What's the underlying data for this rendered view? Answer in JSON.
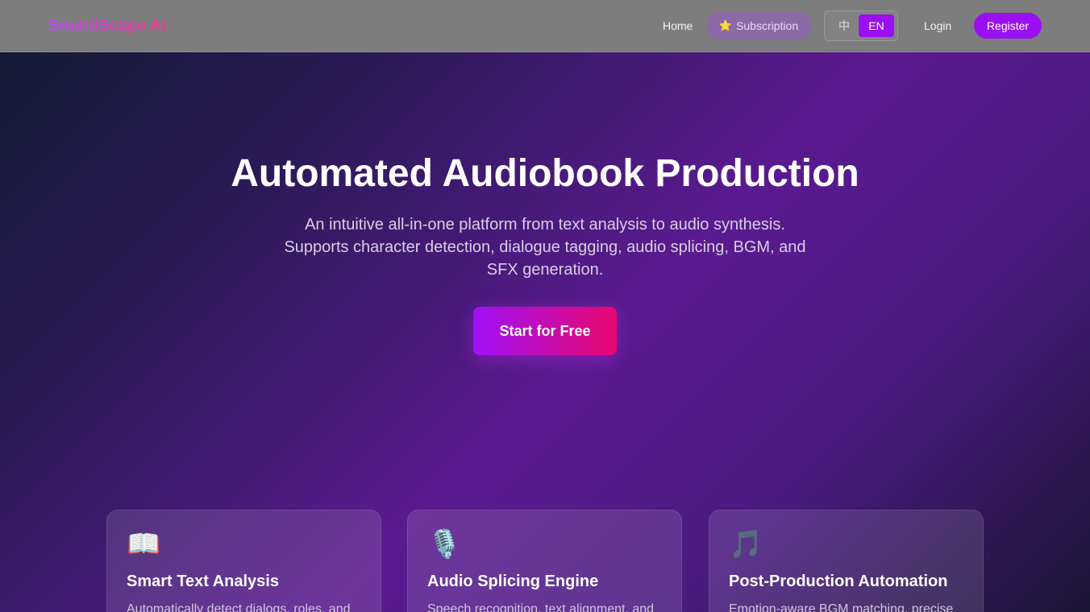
{
  "header": {
    "logo": "SoundScape AI",
    "nav": {
      "home": "Home",
      "subscription": "Subscription",
      "subscription_icon": "⭐",
      "lang_zh": "中",
      "lang_en": "EN",
      "login": "Login",
      "register": "Register"
    },
    "active_language": "EN"
  },
  "hero": {
    "title": "Automated Audiobook Production",
    "subtitle": "An intuitive all-in-one platform from text analysis to audio synthesis. Supports character detection, dialogue tagging, audio splicing, BGM, and SFX generation.",
    "cta": "Start for Free"
  },
  "features": [
    {
      "icon": "📖",
      "icon_name": "open-book-icon",
      "title": "Smart Text Analysis",
      "desc": "Automatically detect dialogs, roles, and"
    },
    {
      "icon": "🎙️",
      "icon_name": "microphone-icon",
      "title": "Audio Splicing Engine",
      "desc": "Speech recognition, text alignment, and"
    },
    {
      "icon": "🎵",
      "icon_name": "music-note-icon",
      "title": "Post-Production Automation",
      "desc": "Emotion-aware BGM matching, precise"
    }
  ],
  "colors": {
    "accent": "#9a10f0",
    "cta_gradient_start": "#a010f8",
    "cta_gradient_end": "#e8086e",
    "topbar": "#7d7d7d"
  }
}
